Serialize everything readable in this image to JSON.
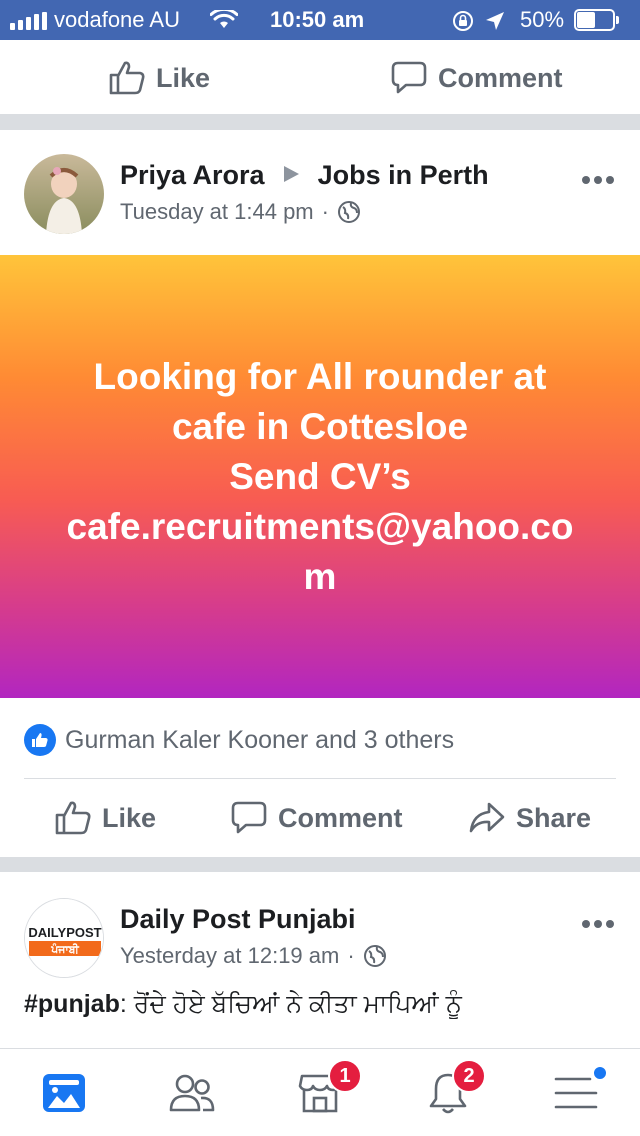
{
  "status_bar": {
    "carrier": "vodafone AU",
    "time": "10:50 am",
    "battery_percent": "50%",
    "battery_level": 0.5
  },
  "previous_post_actions": {
    "like_label": "Like",
    "comment_label": "Comment"
  },
  "post1": {
    "author": "Priya Arora",
    "group": "Jobs in Perth",
    "timestamp": "Tuesday at 1:44 pm",
    "separator": "·",
    "banner_lines": [
      "Looking for All rounder at",
      "cafe in Cottesloe",
      "Send CV’s",
      "cafe.recruitments@yahoo.com"
    ],
    "reactions_text": "Gurman Kaler Kooner and 3 others",
    "like_label": "Like",
    "comment_label": "Comment",
    "share_label": "Share"
  },
  "post2": {
    "author": "Daily Post Punjabi",
    "avatar_text_top": "DAILYPOST",
    "avatar_text_bottom": "ਪੰਜਾਬੀ",
    "timestamp": "Yesterday at 12:19 am",
    "separator": "·",
    "hashtag": "#punjab",
    "text": ": ਰੋਂਦੇ ਹੋਏ ਬੱਚਿਆਂ ਨੇ ਕੀਤਾ ਮਾਪਿਆਂ ਨੂੰ"
  },
  "tab_bar": {
    "tabs": [
      {
        "icon": "news-feed-icon",
        "active": true
      },
      {
        "icon": "friends-icon",
        "active": false
      },
      {
        "icon": "marketplace-icon",
        "badge": "1"
      },
      {
        "icon": "notifications-icon",
        "badge": "2"
      },
      {
        "icon": "menu-icon",
        "dot": true
      }
    ]
  },
  "colors": {
    "brand": "#4267b2",
    "accent": "#1877f2",
    "badge": "#e41e3f"
  }
}
